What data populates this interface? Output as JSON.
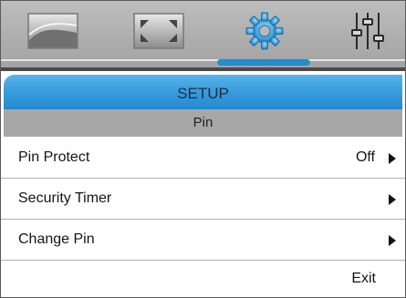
{
  "menu_tabs": [
    {
      "icon": "picture-icon"
    },
    {
      "icon": "display-icon"
    },
    {
      "icon": "setup-gear-icon",
      "active": true
    },
    {
      "icon": "audio-equalizer-icon"
    }
  ],
  "colors": {
    "accent": "#1e90d0",
    "header_gradient_top": "#58b3ea",
    "topbar": "#b0b0b0",
    "subheader": "#a7a7a7"
  },
  "header": {
    "title": "SETUP"
  },
  "subheader": {
    "title": "Pin"
  },
  "items": [
    {
      "label": "Pin Protect",
      "value": "Off"
    },
    {
      "label": "Security Timer",
      "value": ""
    },
    {
      "label": "Change Pin",
      "value": ""
    }
  ],
  "exit_label": "Exit"
}
